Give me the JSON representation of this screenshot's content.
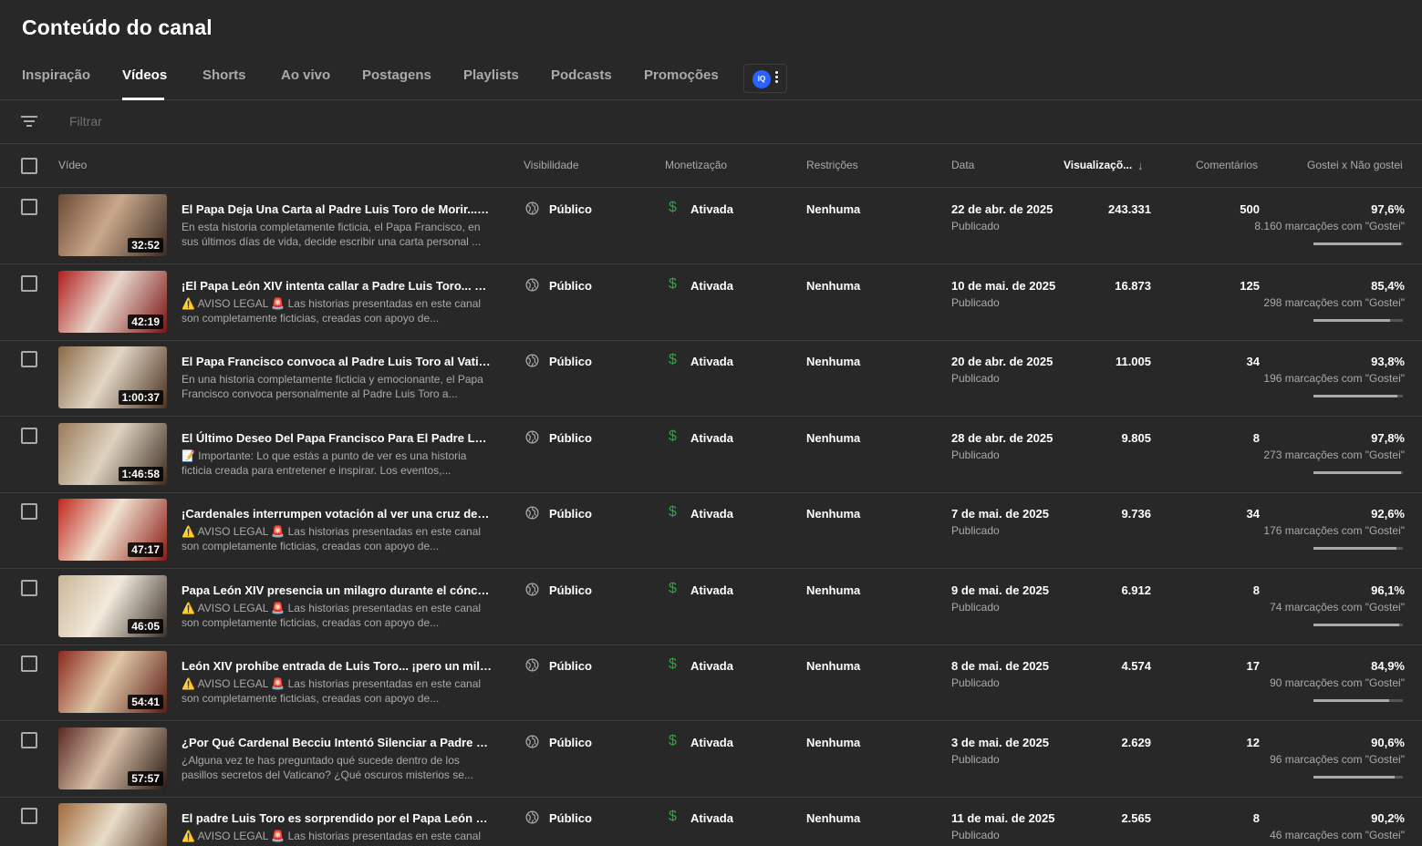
{
  "page": {
    "title": "Conteúdo do canal"
  },
  "tabs": [
    {
      "label": "Inspiração"
    },
    {
      "label": "Vídeos"
    },
    {
      "label": "Shorts"
    },
    {
      "label": "Ao vivo"
    },
    {
      "label": "Postagens"
    },
    {
      "label": "Playlists"
    },
    {
      "label": "Podcasts"
    },
    {
      "label": "Promoções"
    }
  ],
  "extension": {
    "logo_text": "IQ"
  },
  "filter": {
    "placeholder": "Filtrar"
  },
  "columns": {
    "video": "Vídeo",
    "visibility": "Visibilidade",
    "monetization": "Monetização",
    "restrictions": "Restrições",
    "date": "Data",
    "views": "Visualizaçõ...",
    "comments": "Comentários",
    "likes": "Gostei x Não gostei"
  },
  "colors": {
    "background": "#282828",
    "monetization_green": "#2ba640",
    "divider": "#3e3e3e"
  },
  "videos": [
    {
      "duration": "32:52",
      "title": "El Papa Deja Una Carta al Padre Luis Toro de Morir... Y Lo...",
      "desc": "En esta historia completamente ficticia, el Papa Francisco, en sus últimos días de vida, decide escribir una carta personal ...",
      "visibility": "Público",
      "monetization": "Ativada",
      "restrictions": "Nenhuma",
      "date": "22 de abr. de 2025",
      "status": "Publicado",
      "views": "243.331",
      "comments": "500",
      "like_pct": "97,6%",
      "likes_count": "8.160 marcações com \"Gostei\"",
      "like_ratio": 0.976,
      "thumb_colors": [
        "#6b4a35",
        "#c9a88a",
        "#3a2a22"
      ]
    },
    {
      "duration": "42:19",
      "title": "¡El Papa León XIV intenta callar a Padre Luis Toro... pero ...",
      "desc": "⚠️ AVISO LEGAL 🚨 Las historias presentadas en este canal son completamente ficticias, creadas con apoyo de...",
      "visibility": "Público",
      "monetization": "Ativada",
      "restrictions": "Nenhuma",
      "date": "10 de mai. de 2025",
      "status": "Publicado",
      "views": "16.873",
      "comments": "125",
      "like_pct": "85,4%",
      "likes_count": "298 marcações com \"Gostei\"",
      "like_ratio": 0.854,
      "thumb_colors": [
        "#b01e1e",
        "#e8d8cc",
        "#7a1212"
      ]
    },
    {
      "duration": "1:00:37",
      "title": "El Papa Francisco convoca al Padre Luis Toro al Vaticano...",
      "desc": "En una historia completamente ficticia y emocionante, el Papa Francisco convoca personalmente al Padre Luis Toro a...",
      "visibility": "Público",
      "monetization": "Ativada",
      "restrictions": "Nenhuma",
      "date": "20 de abr. de 2025",
      "status": "Publicado",
      "views": "11.005",
      "comments": "34",
      "like_pct": "93,8%",
      "likes_count": "196 marcações com \"Gostei\"",
      "like_ratio": 0.938,
      "thumb_colors": [
        "#8a6a48",
        "#e2d6c4",
        "#4a3222"
      ]
    },
    {
      "duration": "1:46:58",
      "title": "El Último Deseo Del Papa Francisco Para El Padre Luis T...",
      "desc": "📝 Importante: Lo que estás a punto de ver es una historia ficticia creada para entretener e inspirar. Los eventos,...",
      "visibility": "Público",
      "monetization": "Ativada",
      "restrictions": "Nenhuma",
      "date": "28 de abr. de 2025",
      "status": "Publicado",
      "views": "9.805",
      "comments": "8",
      "like_pct": "97,8%",
      "likes_count": "273 marcações com \"Gostei\"",
      "like_ratio": 0.978,
      "thumb_colors": [
        "#9a7a58",
        "#ddd2c0",
        "#3c2c20"
      ]
    },
    {
      "duration": "47:17",
      "title": "¡Cardenales interrumpen votación al ver una cruz de luz s...",
      "desc": "⚠️ AVISO LEGAL 🚨 Las historias presentadas en este canal son completamente ficticias, creadas con apoyo de...",
      "visibility": "Público",
      "monetization": "Ativada",
      "restrictions": "Nenhuma",
      "date": "7 de mai. de 2025",
      "status": "Publicado",
      "views": "9.736",
      "comments": "34",
      "like_pct": "92,6%",
      "likes_count": "176 marcações com \"Gostei\"",
      "like_ratio": 0.926,
      "thumb_colors": [
        "#c0281e",
        "#f0e2d0",
        "#8a1a12"
      ]
    },
    {
      "duration": "46:05",
      "title": "Papa León XIV presencia un milagro durante el cónclave...",
      "desc": "⚠️ AVISO LEGAL 🚨 Las historias presentadas en este canal son completamente ficticias, creadas con apoyo de...",
      "visibility": "Público",
      "monetization": "Ativada",
      "restrictions": "Nenhuma",
      "date": "9 de mai. de 2025",
      "status": "Publicado",
      "views": "6.912",
      "comments": "8",
      "like_pct": "96,1%",
      "likes_count": "74 marcações com \"Gostei\"",
      "like_ratio": 0.961,
      "thumb_colors": [
        "#cbb596",
        "#f2eadc",
        "#3a3028"
      ]
    },
    {
      "duration": "54:41",
      "title": "León XIV prohíbe entrada de Luis Toro... ¡pero un milagro ...",
      "desc": "⚠️ AVISO LEGAL 🚨 Las historias presentadas en este canal son completamente ficticias, creadas con apoyo de...",
      "visibility": "Público",
      "monetization": "Ativada",
      "restrictions": "Nenhuma",
      "date": "8 de mai. de 2025",
      "status": "Publicado",
      "views": "4.574",
      "comments": "17",
      "like_pct": "84,9%",
      "likes_count": "90 marcações com \"Gostei\"",
      "like_ratio": 0.849,
      "thumb_colors": [
        "#8a2a1e",
        "#e0c8a8",
        "#5a1a12"
      ]
    },
    {
      "duration": "57:57",
      "title": "¿Por Qué Cardenal Becciu Intentó Silenciar a Padre Luis ...",
      "desc": "¿Alguna vez te has preguntado qué sucede dentro de los pasillos secretos del Vaticano? ¿Qué oscuros misterios se...",
      "visibility": "Público",
      "monetization": "Ativada",
      "restrictions": "Nenhuma",
      "date": "3 de mai. de 2025",
      "status": "Publicado",
      "views": "2.629",
      "comments": "12",
      "like_pct": "90,6%",
      "likes_count": "96 marcações com \"Gostei\"",
      "like_ratio": 0.906,
      "thumb_colors": [
        "#5a2a22",
        "#d8c0a8",
        "#2a1a14"
      ]
    },
    {
      "duration": "",
      "title": "El padre Luis Toro es sorprendido por el Papa León XIV e...",
      "desc": "⚠️ AVISO LEGAL 🚨 Las historias presentadas en este canal son completamente ficticias, creadas con apoyo de...",
      "visibility": "Público",
      "monetization": "Ativada",
      "restrictions": "Nenhuma",
      "date": "11 de mai. de 2025",
      "status": "Publicado",
      "views": "2.565",
      "comments": "8",
      "like_pct": "90,2%",
      "likes_count": "46 marcações com \"Gostei\"",
      "like_ratio": 0.902,
      "thumb_colors": [
        "#a06a3a",
        "#e8dcc8",
        "#4a2a18"
      ]
    }
  ]
}
